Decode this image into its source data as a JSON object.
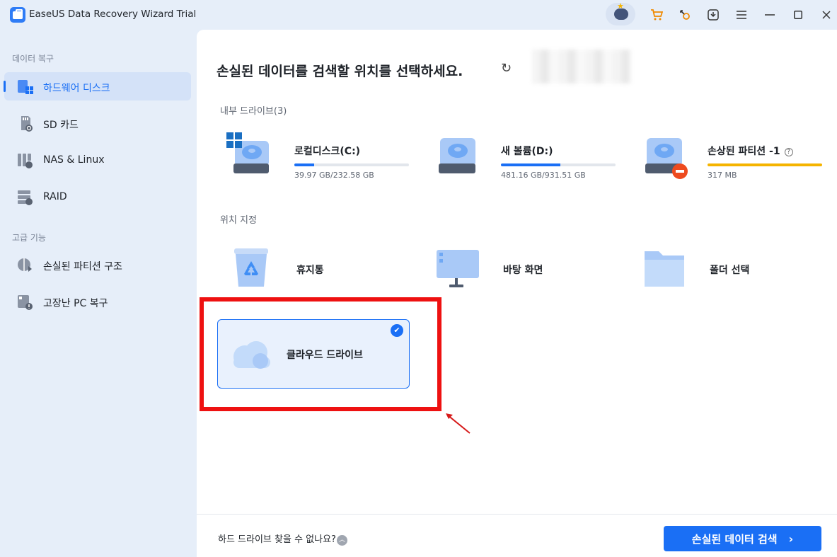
{
  "app": {
    "title": "EaseUS Data Recovery Wizard Trial"
  },
  "titlebar": {
    "icons": [
      "ai-assistant-icon",
      "cart-icon",
      "key-icon",
      "download-icon",
      "menu-icon",
      "minimize-icon",
      "maximize-icon",
      "close-icon"
    ]
  },
  "sidebar": {
    "section1": "데이터 복구",
    "items": [
      {
        "label": "하드웨어 디스크",
        "icon": "hard-disk-icon",
        "active": true
      },
      {
        "label": "SD 카드",
        "icon": "sd-card-icon"
      },
      {
        "label": "NAS & Linux",
        "icon": "nas-icon"
      },
      {
        "label": "RAID",
        "icon": "raid-icon"
      }
    ],
    "section2": "고급 기능",
    "advanced": [
      {
        "label": "손실된 파티션 구조",
        "icon": "partition-icon"
      },
      {
        "label": "고장난 PC 복구",
        "icon": "broken-pc-icon"
      }
    ]
  },
  "main": {
    "title": "손실된 데이터를 검색할 위치를 선택하세요.",
    "internal_label": "내부 드라이브(3)",
    "drives": [
      {
        "name": "로컬디스크(C:)",
        "size": "39.97 GB/232.58 GB",
        "used_fraction": 0.17
      },
      {
        "name": "새 볼륨(D:)",
        "size": "481.16 GB/931.51 GB",
        "used_fraction": 0.52
      },
      {
        "name": "손상된 파티션 -1",
        "size": "317 MB",
        "used_fraction": 1.0
      }
    ],
    "location_label": "위치 지정",
    "locations": [
      {
        "name": "휴지통",
        "icon": "recycle-bin-icon"
      },
      {
        "name": "바탕 화면",
        "icon": "desktop-icon"
      },
      {
        "name": "폴더 선택",
        "icon": "folder-icon"
      }
    ],
    "cloud": {
      "name": "클라우드 드라이브",
      "selected": true
    },
    "footer_text": "하드 드라이브 찾을 수 없나요?",
    "scan_button": "손실된 데이터 검색"
  },
  "colors": {
    "accent": "#1a6ff5",
    "warning": "#f5b400",
    "highlight": "#ee1111"
  }
}
